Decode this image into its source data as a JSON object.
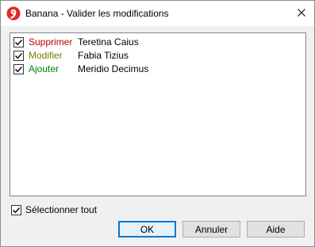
{
  "window": {
    "title": "Banana - Valider les modifications"
  },
  "changes": [
    {
      "action": "Supprimer",
      "name": "Teretina Caius",
      "checked": true,
      "action_color": "#c00000"
    },
    {
      "action": "Modifier",
      "name": "Fabia Tizius",
      "checked": true,
      "action_color": "#7a7a00"
    },
    {
      "action": "Ajouter",
      "name": "Meridio Decimus",
      "checked": true,
      "action_color": "#008000"
    }
  ],
  "select_all": {
    "label": "Sélectionner tout",
    "checked": true
  },
  "buttons": {
    "ok": "OK",
    "cancel": "Annuler",
    "help": "Aide"
  },
  "colors": {
    "default_button_border": "#0078d7",
    "app_icon_red": "#e0282a",
    "app_icon_orange": "#f7a21b"
  }
}
